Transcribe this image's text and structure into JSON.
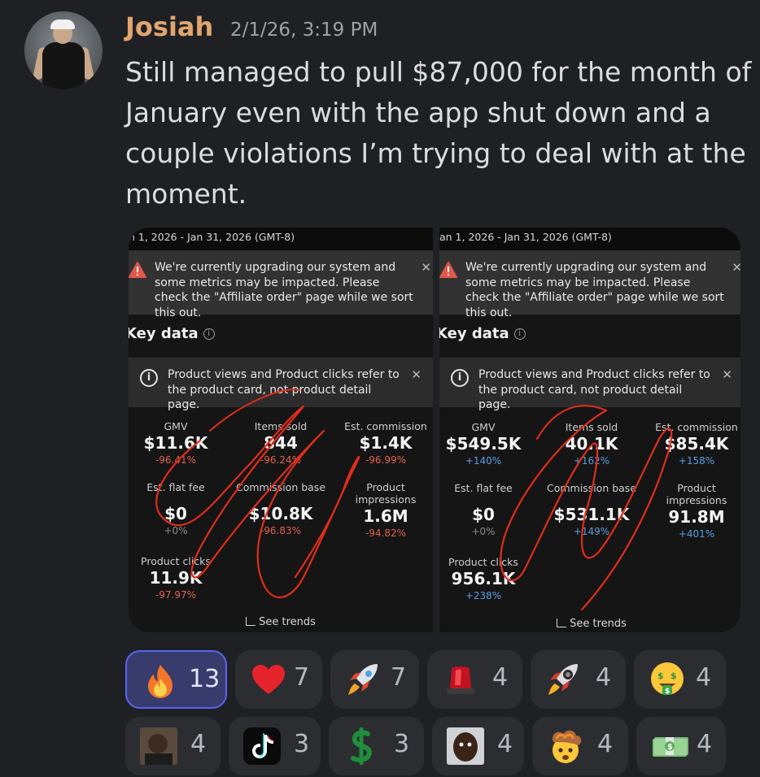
{
  "message": {
    "author": "Josiah",
    "timestamp": "2/1/26, 3:19 PM",
    "text": "Still managed to pull $87,000 for the month of January even with the app shut down and a couple violations I’m trying to deal with at the moment.",
    "author_color": "#e1a570"
  },
  "screenshots": {
    "left": {
      "date_range": "n 1, 2026 - Jan 31, 2026 (GMT-8)",
      "notice": "We're currently upgrading our system and some metrics may be impacted. Please check the \"Affiliate order\" page while we sort this out.",
      "key_data_title": "Key data",
      "tip": "Product views and Product clicks refer to the product card, not product detail page.",
      "see_trends": "See trends",
      "metrics": [
        {
          "label": "GMV",
          "value": "$11.6K",
          "change": "-96.41%",
          "trend": "neg"
        },
        {
          "label": "Items sold",
          "value": "844",
          "change": "-96.24%",
          "trend": "neg"
        },
        {
          "label": "Est. commission",
          "value": "$1.4K",
          "change": "-96.99%",
          "trend": "neg"
        },
        {
          "label": "Est. flat fee",
          "value": "$0",
          "change": "+0%",
          "trend": "neu"
        },
        {
          "label": "Commission base",
          "value": "$10.8K",
          "change": "-96.83%",
          "trend": "neg"
        },
        {
          "label": "Product impressions",
          "value": "1.6M",
          "change": "-94.82%",
          "trend": "neg"
        },
        {
          "label": "Product clicks",
          "value": "11.9K",
          "change": "-97.97%",
          "trend": "neg"
        }
      ]
    },
    "right": {
      "date_range": "an 1, 2026 - Jan 31, 2026 (GMT-8)",
      "notice": "We're currently upgrading our system and some metrics may be impacted. Please check the \"Affiliate order\" page while we sort this out.",
      "key_data_title": "Key data",
      "tip": "Product views and Product clicks refer to the product card, not product detail page.",
      "see_trends": "See trends",
      "metrics": [
        {
          "label": "GMV",
          "value": "$549.5K",
          "change": "+140%",
          "trend": "pos"
        },
        {
          "label": "Items sold",
          "value": "40.1K",
          "change": "+162%",
          "trend": "pos"
        },
        {
          "label": "Est. commission",
          "value": "$85.4K",
          "change": "+158%",
          "trend": "pos"
        },
        {
          "label": "Est. flat fee",
          "value": "$0",
          "change": "+0%",
          "trend": "neu"
        },
        {
          "label": "Commission base",
          "value": "$531.1K",
          "change": "+149%",
          "trend": "pos"
        },
        {
          "label": "Product impressions",
          "value": "91.8M",
          "change": "+401%",
          "trend": "pos"
        },
        {
          "label": "Product clicks",
          "value": "956.1K",
          "change": "+238%",
          "trend": "pos"
        }
      ]
    }
  },
  "reactions": [
    {
      "emoji": "fire",
      "count": "13",
      "active": true
    },
    {
      "emoji": "red-heart",
      "count": "7"
    },
    {
      "emoji": "rocket",
      "count": "7"
    },
    {
      "emoji": "police-siren",
      "count": "4"
    },
    {
      "emoji": "custom-rocket",
      "count": "4"
    },
    {
      "emoji": "money-mouth-face",
      "count": "4"
    },
    {
      "emoji": "custom-face-1",
      "count": "4"
    },
    {
      "emoji": "tiktok-logo",
      "count": "3"
    },
    {
      "emoji": "spinning-dollar",
      "count": "3"
    },
    {
      "emoji": "custom-face-2",
      "count": "4"
    },
    {
      "emoji": "exploding-head",
      "count": "4"
    },
    {
      "emoji": "money-bag-stack",
      "count": "4"
    }
  ]
}
